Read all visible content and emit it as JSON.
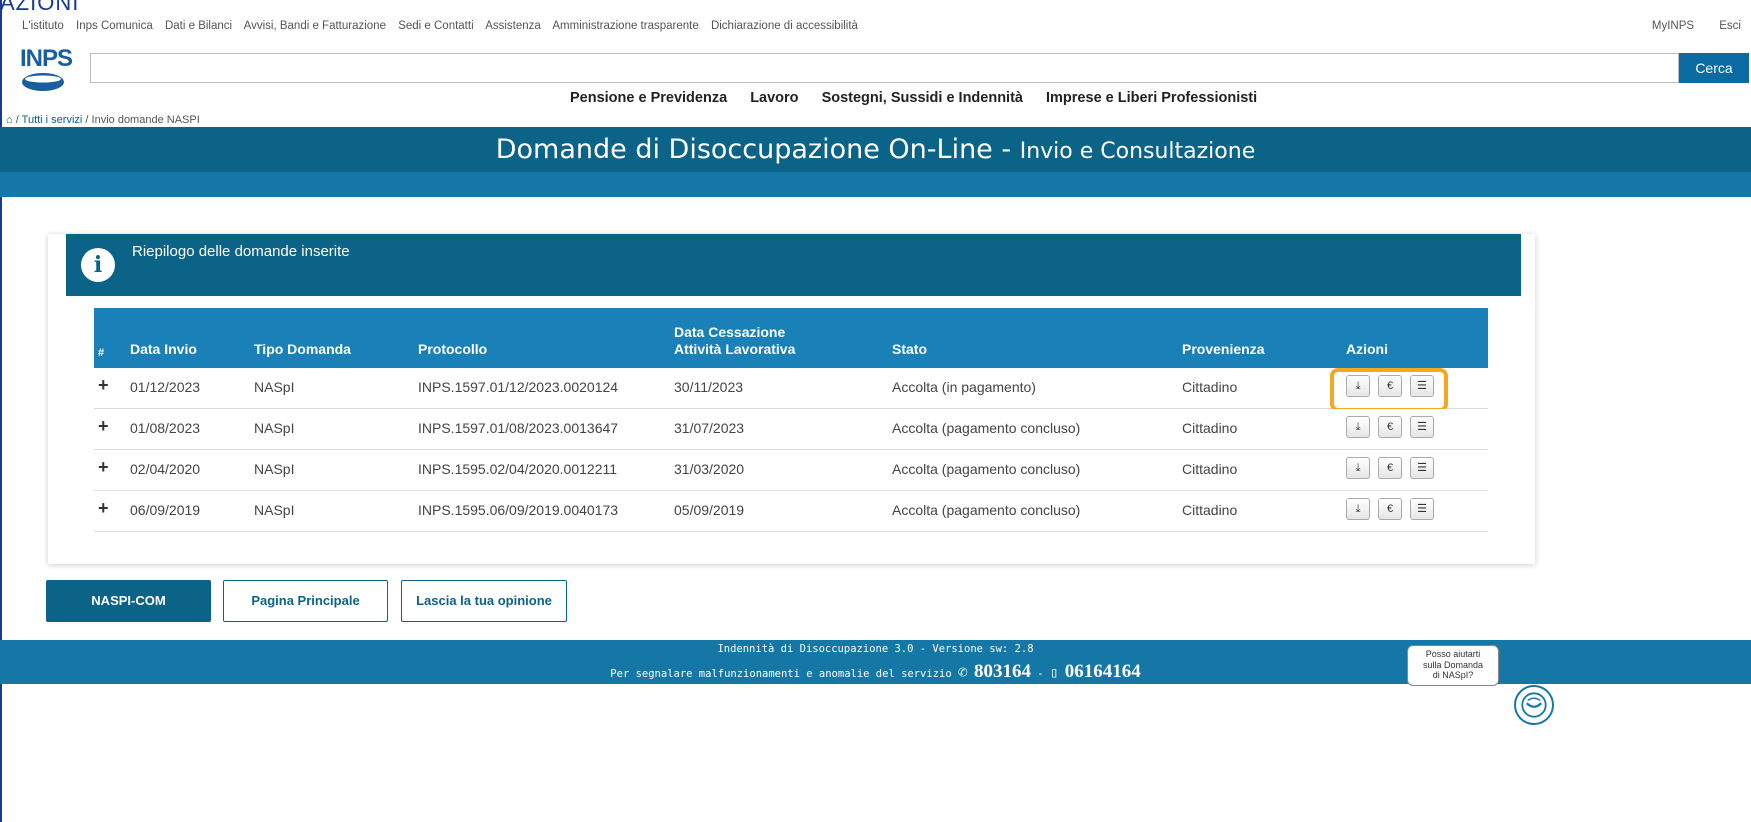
{
  "top_cut_text": "AZIONI",
  "topnav": {
    "links": [
      "L'istituto",
      "Inps Comunica",
      "Dati e Bilanci",
      "Avvisi, Bandi e Fatturazione",
      "Sedi e Contatti",
      "Assistenza",
      "Amministrazione trasparente",
      "Dichiarazione di accessibilità"
    ],
    "myinps": "MyINPS",
    "logout": "Esci"
  },
  "logo_text": "INPS",
  "search": {
    "value": "",
    "button": "Cerca"
  },
  "mainnav": [
    "Pensione e Previdenza",
    "Lavoro",
    "Sostegni, Sussidi e Indennità",
    "Imprese e Liberi Professionisti"
  ],
  "breadcrumb": {
    "home_icon": "home-icon",
    "link": "Tutti i servizi",
    "current": "Invio domande NASPI",
    "sep": " / "
  },
  "hero": {
    "title": "Domande di Disoccupazione On-Line - ",
    "subtitle": "Invio e Consultazione"
  },
  "card": {
    "title": "Riepilogo delle domande inserite"
  },
  "table": {
    "headers": {
      "hash": "#",
      "data_invio": "Data Invio",
      "tipo": "Tipo Domanda",
      "protocollo": "Protocollo",
      "cessazione_1": "Data Cessazione",
      "cessazione_2": "Attività Lavorativa",
      "stato": "Stato",
      "provenienza": "Provenienza",
      "azioni": "Azioni"
    },
    "rows": [
      {
        "expand": "+",
        "data_invio": "01/12/2023",
        "tipo": "NASpI",
        "protocollo": "INPS.1597.01/12/2023.0020124",
        "cessazione": "30/11/2023",
        "stato": "Accolta (in pagamento)",
        "provenienza": "Cittadino"
      },
      {
        "expand": "+",
        "data_invio": "01/08/2023",
        "tipo": "NASpI",
        "protocollo": "INPS.1597.01/08/2023.0013647",
        "cessazione": "31/07/2023",
        "stato": "Accolta (pagamento concluso)",
        "provenienza": "Cittadino"
      },
      {
        "expand": "+",
        "data_invio": "02/04/2020",
        "tipo": "NASpI",
        "protocollo": "INPS.1595.02/04/2020.0012211",
        "cessazione": "31/03/2020",
        "stato": "Accolta (pagamento concluso)",
        "provenienza": "Cittadino"
      },
      {
        "expand": "+",
        "data_invio": "06/09/2019",
        "tipo": "NASpI",
        "protocollo": "INPS.1595.06/09/2019.0040173",
        "cessazione": "05/09/2019",
        "stato": "Accolta (pagamento concluso)",
        "provenienza": "Cittadino"
      }
    ],
    "action_icons": {
      "download": "⤓",
      "euro": "€",
      "list": "☰"
    }
  },
  "buttons": {
    "naspi_com": "NASPI-COM",
    "home": "Pagina Principale",
    "feedback": "Lascia la tua opinione"
  },
  "footer": {
    "line1": "Indennità di Disoccupazione 3.0 - Versione sw: 2.8",
    "line2_prefix": "Per segnalare malfunzionamenti e anomalie del servizio",
    "phone1": "803164",
    "sep": " - ",
    "phone2": "06164164"
  },
  "chat": {
    "line1": "Posso aiutarti",
    "line2": "sulla Domanda",
    "line3": "di NASpI?"
  },
  "colors": {
    "primary": "#0b6388",
    "accent": "#1980b8",
    "band": "#1577a6",
    "highlight": "#f5a623"
  }
}
